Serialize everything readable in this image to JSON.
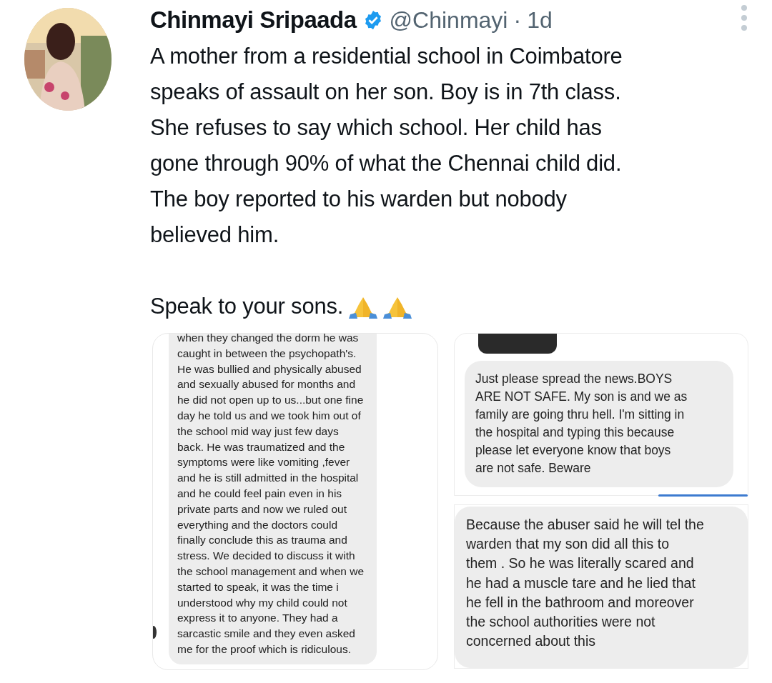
{
  "tweet": {
    "author": {
      "name": "Chinmayi Sripaada",
      "verified": true,
      "handle": "@Chinmayi",
      "separator": "·",
      "time": "1d"
    },
    "paragraphs": [
      "A mother from a residential school in Coimbatore\nspeaks of assault on her son. Boy is in 7th class.\nShe refuses to say which school. Her child has\ngone through 90% of what the Chennai child did.\nThe boy reported to his warden but nobody\nbelieved him.",
      "Speak to your sons."
    ],
    "media": [
      {
        "kind": "chat",
        "messages": [
          "when they changed the dorm he was\ncaught in between the psychopath's.\nHe was bullied and physically abused\nand sexually abused for months and\nhe did not open up to us...but one fine\nday he told us and we took him out of\nthe school mid way just few days\nback. He was traumatized and the\nsymptoms were like vomiting ,fever\nand he is still admitted in the hospital\nand he could feel pain even in his\nprivate parts and now we ruled out\neverything and the doctors could\nfinally conclude this as trauma and\nstress. We decided to discuss it with\nthe school management and when we\nstarted to speak, it was the time i\nunderstood why my child could not\nexpress it to anyone. They had a\nsarcastic smile and they even asked\nme for the proof which is ridiculous."
        ]
      },
      {
        "kind": "chat",
        "messages": [
          "Just please spread the news.BOYS\nARE NOT SAFE. My son is and we as\nfamily are going thru hell. I'm sitting in\nthe hospital and typing this because\nplease let everyone know that boys\nare not safe. Beware"
        ]
      },
      {
        "kind": "chat",
        "messages": [
          "Because the abuser said he will tel the\nwarden that my son did all this to\nthem . So he was literally scared and\nhe had a muscle tare and he lied that\nhe fell in the bathroom and moreover\nthe school authorities were not\nconcerned about this"
        ]
      }
    ]
  }
}
